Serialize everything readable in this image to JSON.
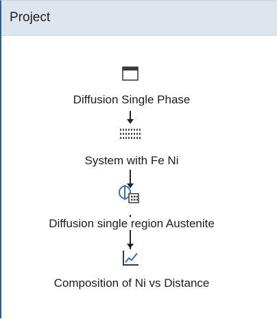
{
  "panel": {
    "title": "Project"
  },
  "tree": {
    "nodes": [
      {
        "label": "Diffusion Single Phase",
        "icon": "window-icon"
      },
      {
        "label": "System with Fe Ni",
        "icon": "system-grid-icon"
      },
      {
        "label": "Diffusion single region Austenite",
        "icon": "diffusion-calculation-icon"
      },
      {
        "label": "Composition of Ni vs Distance",
        "icon": "line-chart-icon"
      }
    ]
  },
  "colors": {
    "header_bg": "#dde6ee",
    "accent_border": "#1f5fa8",
    "icon_blue": "#2e6fd0"
  }
}
